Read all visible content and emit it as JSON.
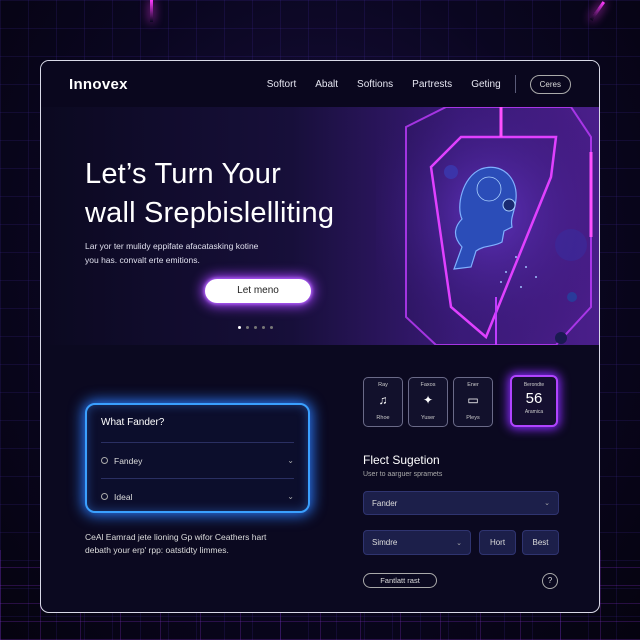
{
  "nav": {
    "logo": "Innovex",
    "links": [
      "Softort",
      "Abalt",
      "Softions",
      "Partrests",
      "Geting"
    ],
    "button": "Ceres"
  },
  "hero": {
    "title_line1": "Let’s Turn Your",
    "title_line2": "wall Srepbislelliting",
    "desc_line1": "Lar yor ter mulidy eppifate afacatasking kotine",
    "desc_line2": "you has. convalt erte emitions.",
    "cta_label": "Let meno"
  },
  "faq": {
    "title": "What Fander?",
    "items": [
      "Fandey",
      "Ideal"
    ]
  },
  "lower_text": {
    "line1": "CeAl Eamrad jete lioning Gp wifor Ceathers hart",
    "line2": "debath your erp' rpp: oatstidty limmes."
  },
  "icon_cards": [
    {
      "top": "Ray",
      "bottom": "Rhoe",
      "icon": "headphones-icon",
      "glyph": "♫"
    },
    {
      "top": "Faxos",
      "bottom": "Yuser",
      "icon": "runner-icon",
      "glyph": "✦"
    },
    {
      "top": "Ener",
      "bottom": "Pleys",
      "icon": "bus-icon",
      "glyph": "▭"
    }
  ],
  "stat_card": {
    "top": "Berondte",
    "value": "56",
    "bottom": "Aramica"
  },
  "suggestion": {
    "title": "Flect Sugetion",
    "subtitle": "User to aarguer spramets",
    "select1": "Fander",
    "select2": "Simdre",
    "btn_next": "Hort",
    "btn_best": "Best",
    "pill": "Fantlatt rast",
    "help": "?"
  },
  "colors": {
    "accent_purple": "#b044ff",
    "accent_blue": "#3aa0ff",
    "window_bg": "#0b0920"
  }
}
